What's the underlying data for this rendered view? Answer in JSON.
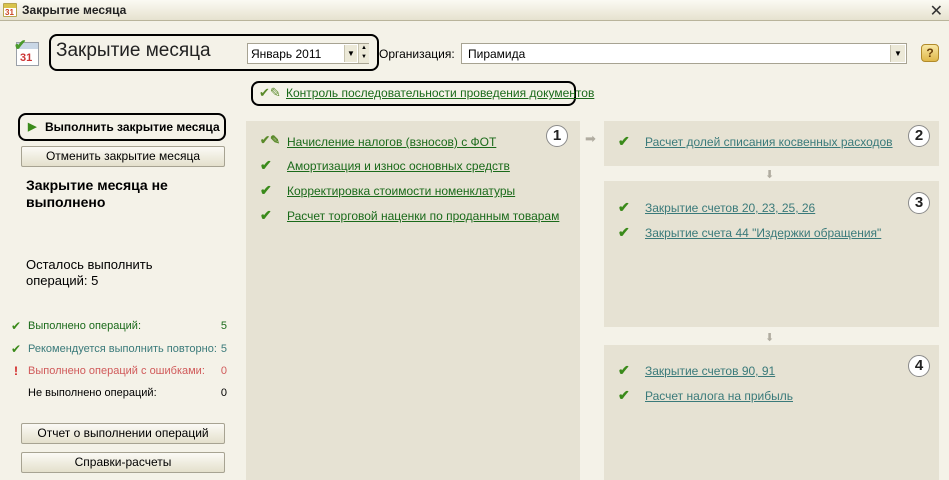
{
  "window": {
    "title": "Закрытие месяца",
    "app_icon_text": "31",
    "close_glyph": "✕"
  },
  "header": {
    "title": "Закрытие месяца",
    "calendar_icon_text": "31",
    "period_value": "Январь 2011",
    "org_label": "Организация:",
    "org_value": "Пирамида",
    "help_glyph": "?"
  },
  "control_link": "Контроль последовательности проведения документов",
  "actions": {
    "run": "Выполнить закрытие месяца",
    "cancel": "Отменить закрытие месяца",
    "report": "Отчет о выполнении операций",
    "reference": "Справки-расчеты"
  },
  "status": {
    "heading": "Закрытие месяца не выполнено",
    "remaining": "Осталось выполнить операций: 5"
  },
  "stats": [
    {
      "label": "Выполнено операций:",
      "count": "5",
      "icon": "check-icon",
      "color": "#1a6a1a"
    },
    {
      "label": "Рекомендуется выполнить повторно:",
      "count": "5",
      "icon": "check-icon",
      "color": "#3a7a7a"
    },
    {
      "label": "Выполнено операций с ошибками:",
      "count": "0",
      "icon": "error-icon",
      "color": "#d05a5a"
    },
    {
      "label": "Не выполнено операций:",
      "count": "0",
      "icon": "none",
      "color": "#000000"
    }
  ],
  "steps": {
    "step1": {
      "number": "1",
      "items": [
        "Начисление налогов (взносов) с ФОТ",
        "Амортизация и износ основных средств",
        "Корректировка стоимости номенклатуры",
        "Расчет торговой наценки по проданным товарам"
      ]
    },
    "step2": {
      "number": "2",
      "items": [
        "Расчет долей списания косвенных расходов"
      ]
    },
    "step3": {
      "number": "3",
      "items": [
        "Закрытие счетов 20, 23, 25, 26",
        "Закрытие счета 44 \"Издержки обращения\""
      ]
    },
    "step4": {
      "number": "4",
      "items": [
        "Закрытие счетов 90, 91",
        "Расчет налога на прибыль"
      ]
    }
  },
  "colors": {
    "accent_green": "#1a6a1a",
    "repeat_teal": "#3a7a7a",
    "error_red": "#d05a5a",
    "panel_bg": "#e6e2d3"
  }
}
